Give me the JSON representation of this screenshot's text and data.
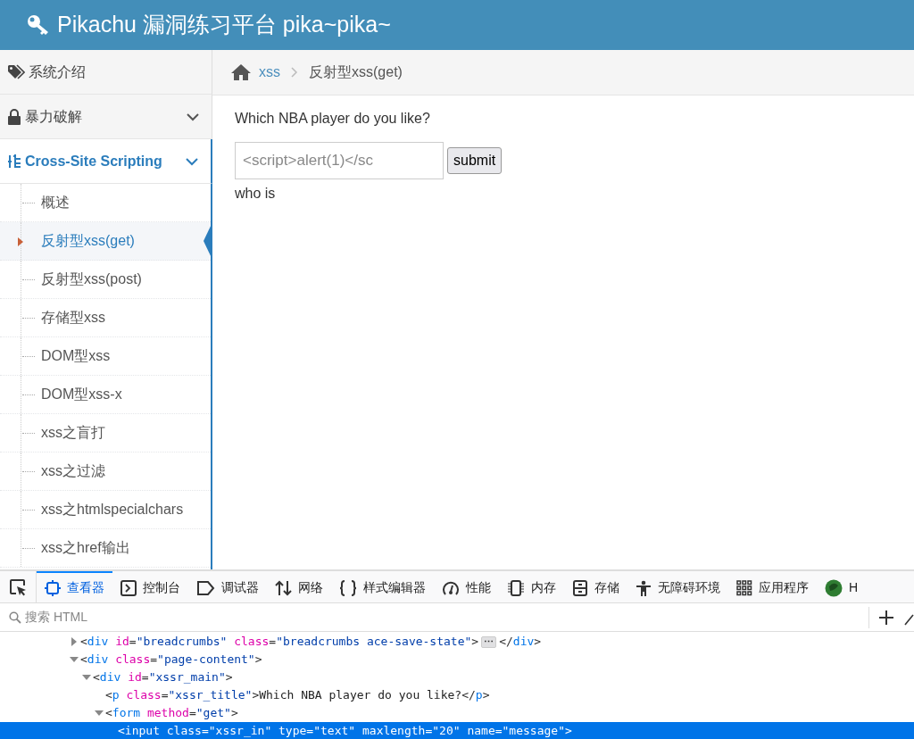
{
  "header": {
    "title": "Pikachu 漏洞练习平台 pika~pika~"
  },
  "sidebar": {
    "items": [
      {
        "kind": "link",
        "label": "系统介绍",
        "selected": false
      },
      {
        "kind": "submenu",
        "label": "暴力破解",
        "selected": false
      },
      {
        "kind": "submenu",
        "label": "Cross-Site Scripting",
        "selected": true,
        "expanded": true,
        "children": [
          {
            "label": "概述",
            "selected": false
          },
          {
            "label": "反射型xss(get)",
            "selected": true
          },
          {
            "label": "反射型xss(post)",
            "selected": false
          },
          {
            "label": "存储型xss",
            "selected": false
          },
          {
            "label": "DOM型xss",
            "selected": false
          },
          {
            "label": "DOM型xss-x",
            "selected": false
          },
          {
            "label": "xss之盲打",
            "selected": false
          },
          {
            "label": "xss之过滤",
            "selected": false
          },
          {
            "label": "xss之htmlspecialchars",
            "selected": false
          },
          {
            "label": "xss之href输出",
            "selected": false
          }
        ]
      }
    ]
  },
  "breadcrumbs": [
    {
      "label": "xss"
    },
    {
      "label": "反射型xss(get)"
    }
  ],
  "content": {
    "question": "Which NBA player do you like?",
    "input": {
      "value": "<script>alert(1)</sc"
    },
    "submit": "submit",
    "result": "who is"
  },
  "devtools": {
    "tabs": [
      {
        "label": "查看器",
        "selected": true
      },
      {
        "label": "控制台",
        "selected": false
      },
      {
        "label": "调试器",
        "selected": false
      },
      {
        "label": "网络",
        "selected": false
      },
      {
        "label": "样式编辑器",
        "selected": false
      },
      {
        "label": "性能",
        "selected": false
      },
      {
        "label": "内存",
        "selected": false
      },
      {
        "label": "存储",
        "selected": false
      },
      {
        "label": "无障碍环境",
        "selected": false
      },
      {
        "label": "应用程序",
        "selected": false
      },
      {
        "label": "H",
        "selected": false
      }
    ],
    "search": {
      "placeholder": "搜索 HTML"
    },
    "lines": [
      {
        "text": "<div id=\"breadcrumbs\" class=\"breadcrumbs ace-save-state\">",
        "badge": "⋯",
        "tail": "</div>",
        "expanded": false,
        "selected": false
      },
      {
        "text": "<div class=\"page-content\">",
        "expanded": true,
        "selected": false,
        "children": [
          {
            "text": "<div id=\"xssr_main\">",
            "expanded": true,
            "selected": false,
            "children": [
              {
                "text": "<p class=\"xssr_title\">Which NBA player do you like?</p>",
                "selected": false
              },
              {
                "text": "<form method=\"get\">",
                "expanded": true,
                "selected": false,
                "children": [
                  {
                    "text": "<input class=\"xssr_in\" type=\"text\" maxlength=\"20\" name=\"message\">",
                    "selected": true
                  }
                ]
              }
            ]
          }
        ]
      }
    ]
  }
}
